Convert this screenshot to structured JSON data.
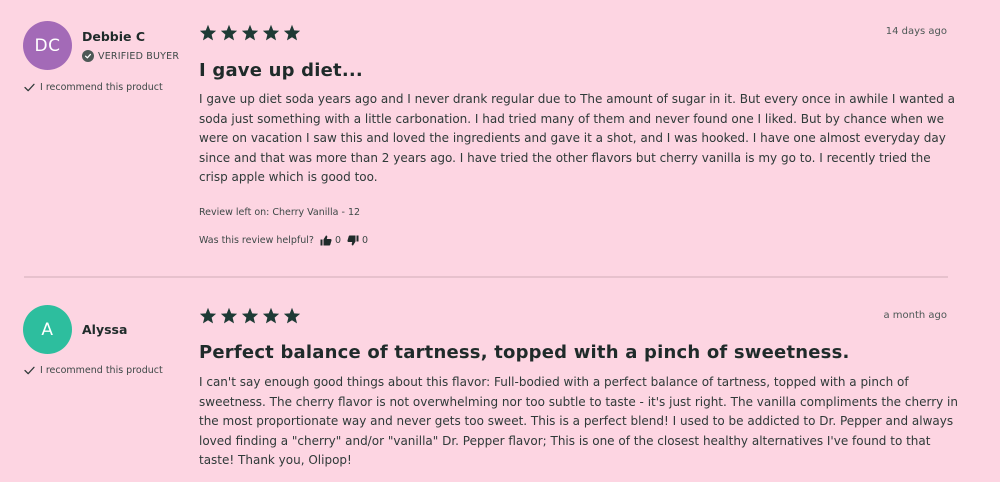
{
  "reviews": [
    {
      "avatar_initials": "DC",
      "avatar_color": "#a36ab7",
      "author": "Debbie C",
      "verified_label": "VERIFIED BUYER",
      "recommend_label": "I recommend this product",
      "rating": 5,
      "date": "14 days ago",
      "title": "I gave up diet...",
      "body": "I gave up diet soda years ago and I never drank regular due to The amount of sugar in it. But every once in awhile I wanted a soda just  something with a little carbonation. I had tried many of them and never found one I liked. But by chance when we were on vacation I saw this and loved the ingredients and gave it a shot, and I was hooked. I have one almost everyday day since and that was more than 2 years ago. I have tried the other flavors but cherry vanilla is my go to. I recently tried the crisp apple which is good too.",
      "review_left_on": "Review left on: Cherry Vanilla - 12",
      "helpful_label": "Was this review helpful?",
      "thumbs_up_count": "0",
      "thumbs_down_count": "0"
    },
    {
      "avatar_initials": "A",
      "avatar_color": "#2dbe9e",
      "author": "Alyssa",
      "recommend_label": "I recommend this product",
      "rating": 5,
      "date": "a month ago",
      "title": "Perfect balance of tartness, topped with a pinch of sweetness.",
      "body": "I can't say enough good things about this flavor: Full-bodied with a perfect balance of tartness, topped with a pinch of sweetness. The cherry flavor is not overwhelming nor too subtle to taste - it's just right. The vanilla compliments the cherry in the most proportionate way and never gets too sweet. This is a perfect blend! I used to be addicted to Dr. Pepper and always loved finding a \"cherry\" and/or \"vanilla\" Dr. Pepper flavor; This is one of the closest healthy alternatives I've found to that taste! Thank you, Olipop!"
    }
  ],
  "colors": {
    "star": "#1e3a35",
    "background": "#fdd5e2"
  },
  "icons": {
    "star": "star-icon",
    "check": "check-icon",
    "verified": "verified-check-icon",
    "thumbs_up": "thumbs-up-icon",
    "thumbs_down": "thumbs-down-icon"
  }
}
